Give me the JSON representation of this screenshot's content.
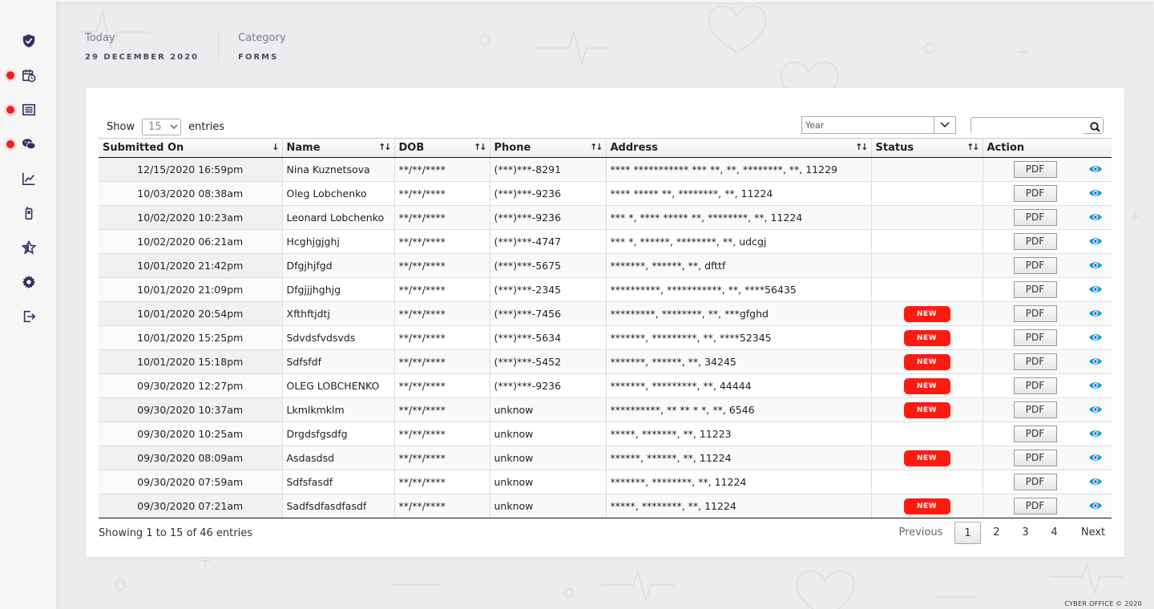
{
  "header": {
    "today_label": "Today",
    "today_value": "29 DECEMBER 2020",
    "category_label": "Category",
    "category_value": "FORMS"
  },
  "sidebar": {
    "items": [
      {
        "icon": "shield-check-icon",
        "notify": false
      },
      {
        "icon": "calendar-clock-icon",
        "notify": true
      },
      {
        "icon": "list-icon",
        "notify": true
      },
      {
        "icon": "chat-icon",
        "notify": true
      },
      {
        "icon": "chart-line-icon",
        "notify": false
      },
      {
        "icon": "phone-icon",
        "notify": false
      },
      {
        "icon": "star-icon",
        "notify": false
      },
      {
        "icon": "gear-icon",
        "notify": false
      },
      {
        "icon": "logout-icon",
        "notify": false
      }
    ]
  },
  "controls": {
    "show_label": "Show",
    "entries_value": "15",
    "entries_label": "entries",
    "year_placeholder": "Year",
    "search_value": ""
  },
  "table": {
    "columns": [
      "Submitted On",
      "Name",
      "DOB",
      "Phone",
      "Address",
      "Status",
      "Action"
    ],
    "pdf_label": "PDF",
    "rows": [
      {
        "submitted": "12/15/2020 16:59pm",
        "name": "Nina Kuznetsova",
        "dob": "**/**/****",
        "phone": "(***)***-8291",
        "address": "**** *********** *** **, **, ********, **, 11229",
        "status": ""
      },
      {
        "submitted": "10/03/2020 08:38am",
        "name": "Oleg Lobchenko",
        "dob": "**/**/****",
        "phone": "(***)***-9236",
        "address": "**** ***** **, ********, **, 11224",
        "status": ""
      },
      {
        "submitted": "10/02/2020 10:23am",
        "name": "Leonard Lobchenko",
        "dob": "**/**/****",
        "phone": "(***)***-9236",
        "address": "*** *, **** ***** **, ********, **, 11224",
        "status": ""
      },
      {
        "submitted": "10/02/2020 06:21am",
        "name": "Hcghjgjghj",
        "dob": "**/**/****",
        "phone": "(***)***-4747",
        "address": "*** *, ******, ********, **, udcgj",
        "status": ""
      },
      {
        "submitted": "10/01/2020 21:42pm",
        "name": "Dfgjhjfgd",
        "dob": "**/**/****",
        "phone": "(***)***-5675",
        "address": "*******, ******, **, dfttf",
        "status": ""
      },
      {
        "submitted": "10/01/2020 21:09pm",
        "name": "Dfgjjjhghjg",
        "dob": "**/**/****",
        "phone": "(***)***-2345",
        "address": "**********, ***********, **, ****56435",
        "status": ""
      },
      {
        "submitted": "10/01/2020 20:54pm",
        "name": "Xfthftjdtj",
        "dob": "**/**/****",
        "phone": "(***)***-7456",
        "address": "*********, ********, **, ***gfghd",
        "status": "NEW"
      },
      {
        "submitted": "10/01/2020 15:25pm",
        "name": "Sdvdsfvdsvds",
        "dob": "**/**/****",
        "phone": "(***)***-5634",
        "address": "*******, *********, **, ****52345",
        "status": "NEW"
      },
      {
        "submitted": "10/01/2020 15:18pm",
        "name": "Sdfsfdf",
        "dob": "**/**/****",
        "phone": "(***)***-5452",
        "address": "*******, ******, **, 34245",
        "status": "NEW"
      },
      {
        "submitted": "09/30/2020 12:27pm",
        "name": "OLEG LOBCHENKO",
        "dob": "**/**/****",
        "phone": "(***)***-9236",
        "address": "*******, *********, **, 44444",
        "status": "NEW"
      },
      {
        "submitted": "09/30/2020 10:37am",
        "name": "Lkmlkmklm",
        "dob": "**/**/****",
        "phone": "unknow",
        "address": "**********, ** ** * *, **, 6546",
        "status": "NEW"
      },
      {
        "submitted": "09/30/2020 10:25am",
        "name": "Drgdsfgsdfg",
        "dob": "**/**/****",
        "phone": "unknow",
        "address": "*****, *******, **, 11223",
        "status": ""
      },
      {
        "submitted": "09/30/2020 08:09am",
        "name": "Asdasdsd",
        "dob": "**/**/****",
        "phone": "unknow",
        "address": "******, ******, **, 11224",
        "status": "NEW"
      },
      {
        "submitted": "09/30/2020 07:59am",
        "name": "Sdfsfasdf",
        "dob": "**/**/****",
        "phone": "unknow",
        "address": "*******, ********, **, 11224",
        "status": ""
      },
      {
        "submitted": "09/30/2020 07:21am",
        "name": "Sadfsdfasdfasdf",
        "dob": "**/**/****",
        "phone": "unknow",
        "address": "*****, ********, **, 11224",
        "status": "NEW"
      }
    ]
  },
  "pagination": {
    "summary": "Showing 1 to 15 of 46 entries",
    "previous": "Previous",
    "pages": [
      "1",
      "2",
      "3",
      "4"
    ],
    "current": "1",
    "next": "Next"
  },
  "footer": {
    "copyright": "CYBER OFFICE © 2020"
  },
  "colors": {
    "accent": "#3b2d5f",
    "notify": "#ee1e25",
    "badge": "#ff1a10",
    "eye": "#1e9bd7"
  }
}
